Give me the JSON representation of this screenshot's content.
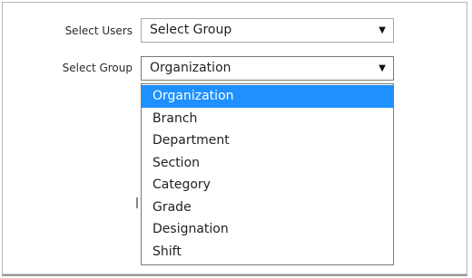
{
  "form": {
    "select_users": {
      "label": "Select Users",
      "value": "Select Group"
    },
    "select_group": {
      "label": "Select Group",
      "value": "Organization",
      "options": [
        "Organization",
        "Branch",
        "Department",
        "Section",
        "Category",
        "Grade",
        "Designation",
        "Shift"
      ],
      "selected_index": 0
    }
  },
  "colors": {
    "selection_highlight": "#1e90ff",
    "border": "#a9a9a9"
  },
  "icons": {
    "dropdown_arrow": "triangle-down-icon"
  }
}
